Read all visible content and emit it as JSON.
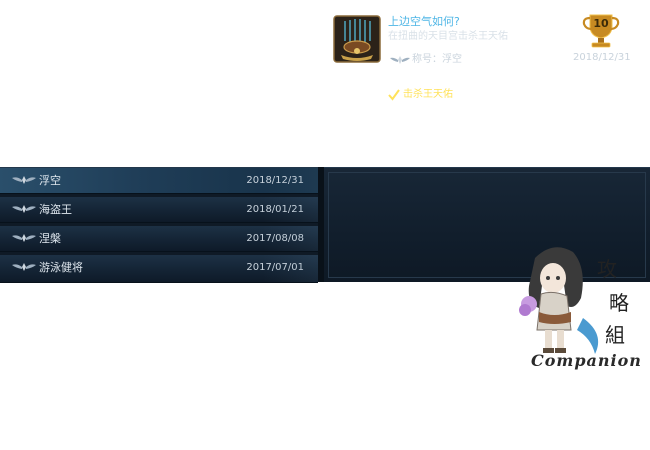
{
  "titles": [
    {
      "name": "浮空",
      "date": "2018/12/31",
      "selected": true
    },
    {
      "name": "海盗王",
      "date": "2018/01/21",
      "selected": false
    },
    {
      "name": "涅槃",
      "date": "2017/08/08",
      "selected": false
    },
    {
      "name": "游泳健将",
      "date": "2017/07/01",
      "selected": false
    }
  ],
  "detail": {
    "title": "上边空气如何?",
    "description": "在扭曲的天目宫击杀王天佑",
    "reward_label": "称号：浮空",
    "trophy_number": "10",
    "trophy_date": "2018/12/31",
    "objective": "击杀王天佑"
  },
  "watermark": {
    "brand": "Companion",
    "chars": "攻略組"
  },
  "colors": {
    "title_accent": "#4fb6e6",
    "objective": "#ffe25a",
    "panel_bg": "#111e2c"
  }
}
